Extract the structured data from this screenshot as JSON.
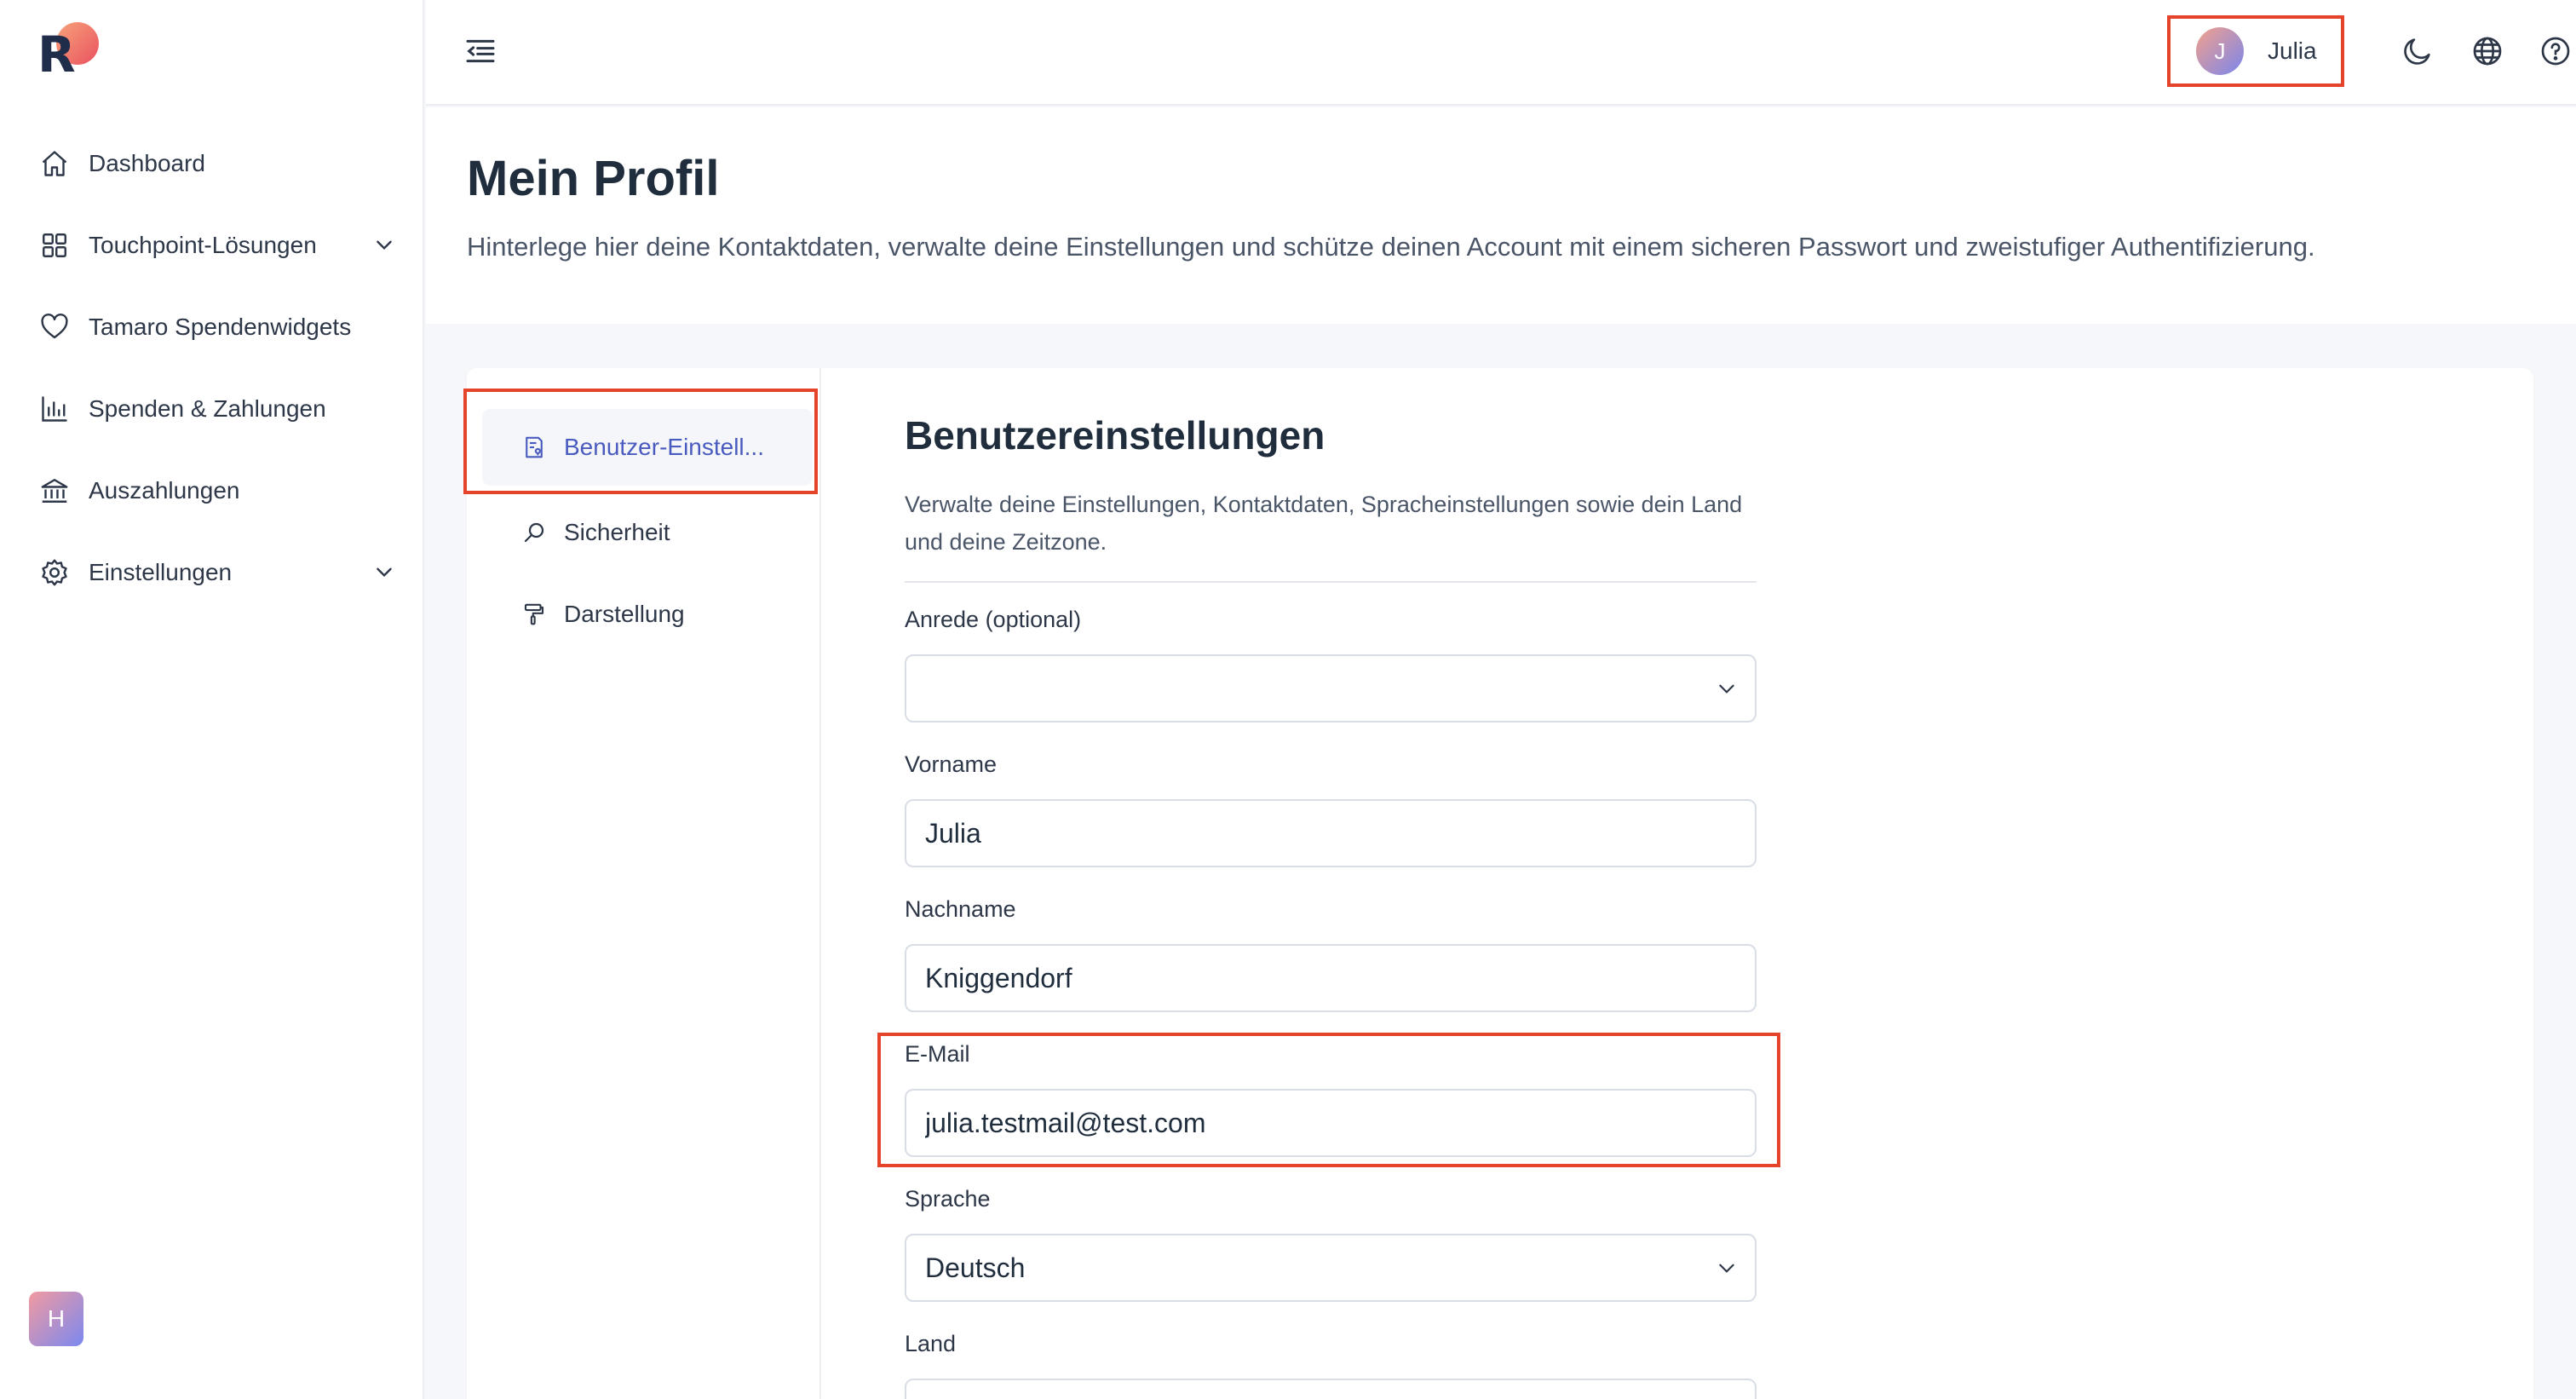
{
  "sidebar": {
    "logo_letter": "R",
    "items": [
      {
        "label": "Dashboard",
        "icon": "home-icon"
      },
      {
        "label": "Touchpoint-Lösungen",
        "icon": "grid-icon",
        "expandable": true
      },
      {
        "label": "Tamaro Spendenwidgets",
        "icon": "heart-icon"
      },
      {
        "label": "Spenden & Zahlungen",
        "icon": "bar-chart-icon"
      },
      {
        "label": "Auszahlungen",
        "icon": "bank-icon"
      },
      {
        "label": "Einstellungen",
        "icon": "gear-icon",
        "expandable": true
      }
    ],
    "bottom_badge": "H"
  },
  "topbar": {
    "user": {
      "initial": "J",
      "name": "Julia"
    },
    "icons": [
      "moon-icon",
      "globe-icon",
      "help-icon"
    ]
  },
  "header": {
    "title": "Mein Profil",
    "subtitle": "Hinterlege hier deine Kontaktdaten, verwalte deine Einstellungen und schütze deinen Account mit einem sicheren Passwort und zweistufiger Authentifizierung."
  },
  "subnav": {
    "items": [
      {
        "label": "Benutzer-Einstell...",
        "icon": "user-settings-icon",
        "active": true
      },
      {
        "label": "Sicherheit",
        "icon": "search-icon"
      },
      {
        "label": "Darstellung",
        "icon": "paint-roller-icon"
      }
    ]
  },
  "section": {
    "title": "Benutzereinstellungen",
    "description": "Verwalte deine Einstellungen, Kontaktdaten, Spracheinstellungen sowie dein Land und deine Zeitzone.",
    "fields": {
      "salutation": {
        "label": "Anrede (optional)",
        "value": ""
      },
      "first_name": {
        "label": "Vorname",
        "value": "Julia"
      },
      "last_name": {
        "label": "Nachname",
        "value": "Kniggendorf"
      },
      "email": {
        "label": "E-Mail",
        "value": "julia.testmail@test.com"
      },
      "language": {
        "label": "Sprache",
        "value": "Deutsch"
      },
      "country": {
        "label": "Land",
        "value": ""
      }
    }
  },
  "colors": {
    "highlight": "#e5442b",
    "active_text": "#4a5bbf",
    "logo_gradient": [
      "#f7a37a",
      "#ea5160"
    ]
  }
}
